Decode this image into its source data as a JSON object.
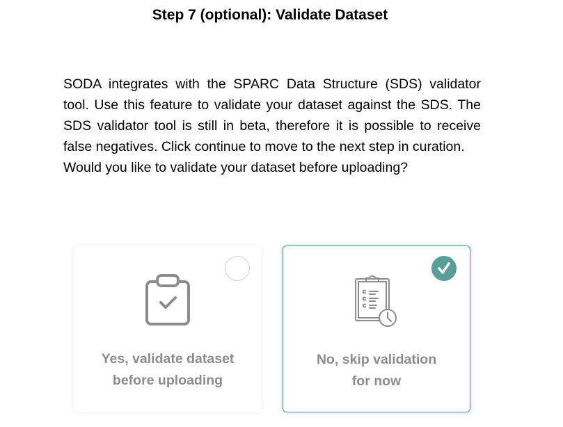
{
  "header": {
    "title": "Step 7 (optional): Validate Dataset"
  },
  "description": {
    "paragraph": "SODA integrates with the SPARC Data Structure (SDS) validator tool. Use this feature to validate your dataset against the SDS. The SDS validator tool is still in beta, therefore it is possible to receive false negatives. Click continue to move to the next step in curation.",
    "question": "Would you like to validate your dataset before uploading?"
  },
  "options": [
    {
      "line1": "Yes, validate dataset",
      "line2": "before uploading",
      "icon": "clipboard-check-icon",
      "selected": false
    },
    {
      "line1": "No, skip validation",
      "line2": "for now",
      "icon": "clipboard-list-clock-icon",
      "selected": true
    }
  ],
  "colors": {
    "accent": "#5a9e98",
    "muted_text": "#8c8c8c"
  }
}
